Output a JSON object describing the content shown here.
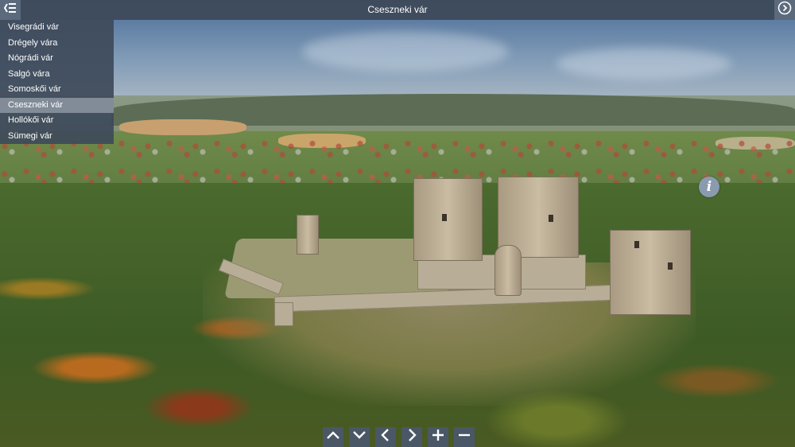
{
  "header": {
    "title": "Cseszneki vár",
    "menu_icon": "menu-collapse-icon",
    "autoplay_icon": "play-circle-icon"
  },
  "sidebar": {
    "items": [
      {
        "label": "Visegrádi vár",
        "active": false
      },
      {
        "label": "Drégely vára",
        "active": false
      },
      {
        "label": "Nógrádi vár",
        "active": false
      },
      {
        "label": "Salgó vára",
        "active": false
      },
      {
        "label": "Somoskői vár",
        "active": false
      },
      {
        "label": "Cseszneki vár",
        "active": true
      },
      {
        "label": "Hollókői vár",
        "active": false
      },
      {
        "label": "Sümegi vár",
        "active": false
      }
    ]
  },
  "info_button": {
    "glyph": "i",
    "icon": "info-icon"
  },
  "controls": [
    {
      "icon": "chevron-up-icon"
    },
    {
      "icon": "chevron-down-icon"
    },
    {
      "icon": "chevron-left-icon"
    },
    {
      "icon": "chevron-right-icon"
    },
    {
      "icon": "zoom-in-plus-icon"
    },
    {
      "icon": "zoom-out-minus-icon"
    }
  ],
  "colors": {
    "bar_background": "#3e4a5a",
    "active_item": "#969fac",
    "control_background": "#4a576a",
    "info_button": "#8a9bb0"
  }
}
